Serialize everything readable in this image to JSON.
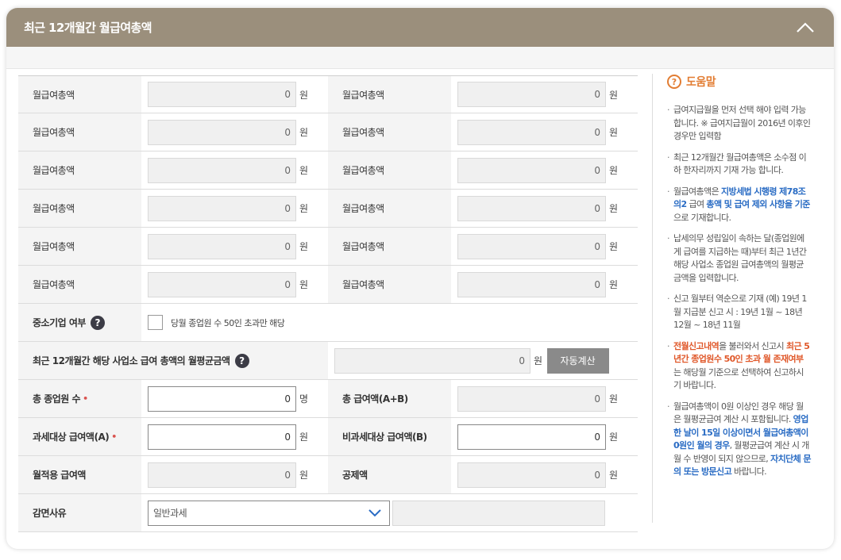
{
  "header": {
    "title": "최근 12개월간 월급여총액"
  },
  "monthly_rows": [
    {
      "left_label": "월급여총액",
      "left_value": "0",
      "right_label": "월급여총액",
      "right_value": "0"
    },
    {
      "left_label": "월급여총액",
      "left_value": "0",
      "right_label": "월급여총액",
      "right_value": "0"
    },
    {
      "left_label": "월급여총액",
      "left_value": "0",
      "right_label": "월급여총액",
      "right_value": "0"
    },
    {
      "left_label": "월급여총액",
      "left_value": "0",
      "right_label": "월급여총액",
      "right_value": "0"
    },
    {
      "left_label": "월급여총액",
      "left_value": "0",
      "right_label": "월급여총액",
      "right_value": "0"
    },
    {
      "left_label": "월급여총액",
      "left_value": "0",
      "right_label": "월급여총액",
      "right_value": "0"
    }
  ],
  "units": {
    "won": "원",
    "person": "명"
  },
  "sme": {
    "label": "중소기업 여부",
    "checkbox_label": "당월 종업원 수 50인 초과만 해당"
  },
  "average": {
    "label": "최근 12개월간 해당 사업소 급여 총액의 월평균금액",
    "value": "0",
    "button": "자동계산"
  },
  "employees": {
    "label": "총 종업원 수",
    "value": "0"
  },
  "total_pay": {
    "label": "총 급여액(A+B)",
    "value": "0"
  },
  "taxable": {
    "label": "과세대상 급여액(A)",
    "value": "0"
  },
  "nontaxable": {
    "label": "비과세대상 급여액(B)",
    "value": "0"
  },
  "applied": {
    "label": "월적용 급여액",
    "value": "0"
  },
  "deduction": {
    "label": "공제액",
    "value": "0"
  },
  "reduction": {
    "label": "감면사유",
    "selected": "일반과세"
  },
  "help": {
    "title": "도움말",
    "items": [
      {
        "parts": [
          {
            "t": "급여지급월을 먼저 선택 해야 입력 가능 합니다. ※ 급여지급월이 2016년 이후인 경우만 입력함",
            "c": ""
          }
        ]
      },
      {
        "parts": [
          {
            "t": "최근 12개월간 월급여총액은 소수점 이하 한자리까지 기재 가능 합니다.",
            "c": ""
          }
        ]
      },
      {
        "parts": [
          {
            "t": "월급여총액은 ",
            "c": ""
          },
          {
            "t": "지방세법 시행령 제78조의2",
            "c": "blue"
          },
          {
            "t": " 급여 ",
            "c": ""
          },
          {
            "t": "총액 및 급여 제외 사항을 기준",
            "c": "blue"
          },
          {
            "t": "으로 기재합니다.",
            "c": ""
          }
        ]
      },
      {
        "parts": [
          {
            "t": "납세의무 성립일이 속하는 달(종업원에게 급여를 지급하는 때)부터 최근 1년간 해당 사업소 종업원 급여총액의 월평균금액을 입력합니다.",
            "c": ""
          }
        ]
      },
      {
        "parts": [
          {
            "t": "신고 월부터 역순으로 기재 (예) 19년 1월 지급분 신고 시 : 19년 1월 ~ 18년 12월 ~ 18년 11월",
            "c": ""
          }
        ]
      },
      {
        "parts": [
          {
            "t": "전월신고내역",
            "c": "orange"
          },
          {
            "t": "을 불러와서 신고시 ",
            "c": ""
          },
          {
            "t": "최근 5년간 종업원수 50인 초과 월 존재여부",
            "c": "orange"
          },
          {
            "t": "는 해당월 기준으로 선택하여 신고하시기 바랍니다.",
            "c": ""
          }
        ]
      },
      {
        "parts": [
          {
            "t": "월급여총액이 0원 이상인 경우 해당 월은 월평균급여 계산 시 포함됩니다. ",
            "c": ""
          },
          {
            "t": "영업한 날이 15일 이상이면서 월급여총액이 0원인 월의 경우",
            "c": "blue"
          },
          {
            "t": ", 월평균급여 계산 시 개월 수 반영이 되지 않으므로, ",
            "c": ""
          },
          {
            "t": "자치단체 문의 또는 방문신고",
            "c": "blue"
          },
          {
            "t": " 바랍니다.",
            "c": ""
          }
        ]
      }
    ]
  }
}
